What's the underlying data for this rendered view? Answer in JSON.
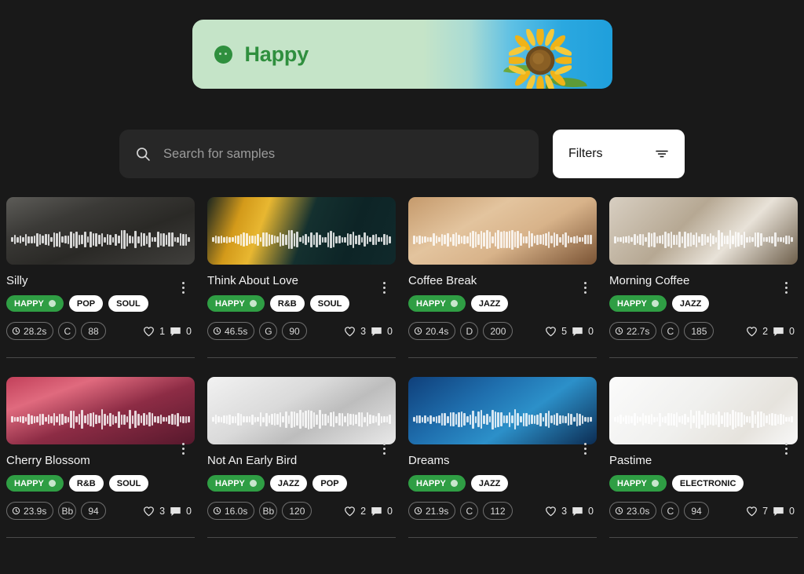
{
  "hero": {
    "title": "Happy",
    "dot_icon": "mood-happy-dot-icon",
    "image_alt": "sunflower-photo"
  },
  "search": {
    "placeholder": "Search for samples",
    "value": "",
    "icon": "search-icon"
  },
  "filters": {
    "label": "Filters",
    "icon": "filter-icon"
  },
  "colors": {
    "background": "#191919",
    "accent_green": "#2f9e44",
    "hero_green_text": "#2f8f3e",
    "surface": "#272727",
    "divider": "#4a4a4a"
  },
  "samples": [
    {
      "title": "Silly",
      "tags": [
        "HAPPY",
        "POP",
        "SOUL"
      ],
      "duration": "28.2s",
      "key": "C",
      "bpm": "88",
      "likes": "1",
      "comments": "0",
      "thumb": "dog-with-googly-glasses"
    },
    {
      "title": "Think About Love",
      "tags": [
        "HAPPY",
        "R&B",
        "SOUL"
      ],
      "duration": "46.5s",
      "key": "G",
      "bpm": "90",
      "likes": "3",
      "comments": "0",
      "thumb": "love-neon-sign"
    },
    {
      "title": "Coffee Break",
      "tags": [
        "HAPPY",
        "JAZZ"
      ],
      "duration": "20.4s",
      "key": "D",
      "bpm": "200",
      "likes": "5",
      "comments": "0",
      "thumb": "iced-coffee-on-table"
    },
    {
      "title": "Morning Coffee",
      "tags": [
        "HAPPY",
        "JAZZ"
      ],
      "duration": "22.7s",
      "key": "C",
      "bpm": "185",
      "likes": "2",
      "comments": "0",
      "thumb": "life-begins-after-coffee-mug"
    },
    {
      "title": "Cherry Blossom",
      "tags": [
        "HAPPY",
        "R&B",
        "SOUL"
      ],
      "duration": "23.9s",
      "key": "Bb",
      "bpm": "94",
      "likes": "3",
      "comments": "0",
      "thumb": "cherry-blossom-canal"
    },
    {
      "title": "Not An Early Bird",
      "tags": [
        "HAPPY",
        "JAZZ",
        "POP"
      ],
      "duration": "16.0s",
      "key": "Bb",
      "bpm": "120",
      "likes": "2",
      "comments": "0",
      "thumb": "cat-sleeping-under-blanket"
    },
    {
      "title": "Dreams",
      "tags": [
        "HAPPY",
        "JAZZ"
      ],
      "duration": "21.9s",
      "key": "C",
      "bpm": "112",
      "likes": "3",
      "comments": "0",
      "thumb": "blue-light-painting"
    },
    {
      "title": "Pastime",
      "tags": [
        "HAPPY",
        "ELECTRONIC"
      ],
      "duration": "23.0s",
      "key": "C",
      "bpm": "94",
      "likes": "7",
      "comments": "0",
      "thumb": "navy-yarn-and-knitting-needles"
    }
  ]
}
